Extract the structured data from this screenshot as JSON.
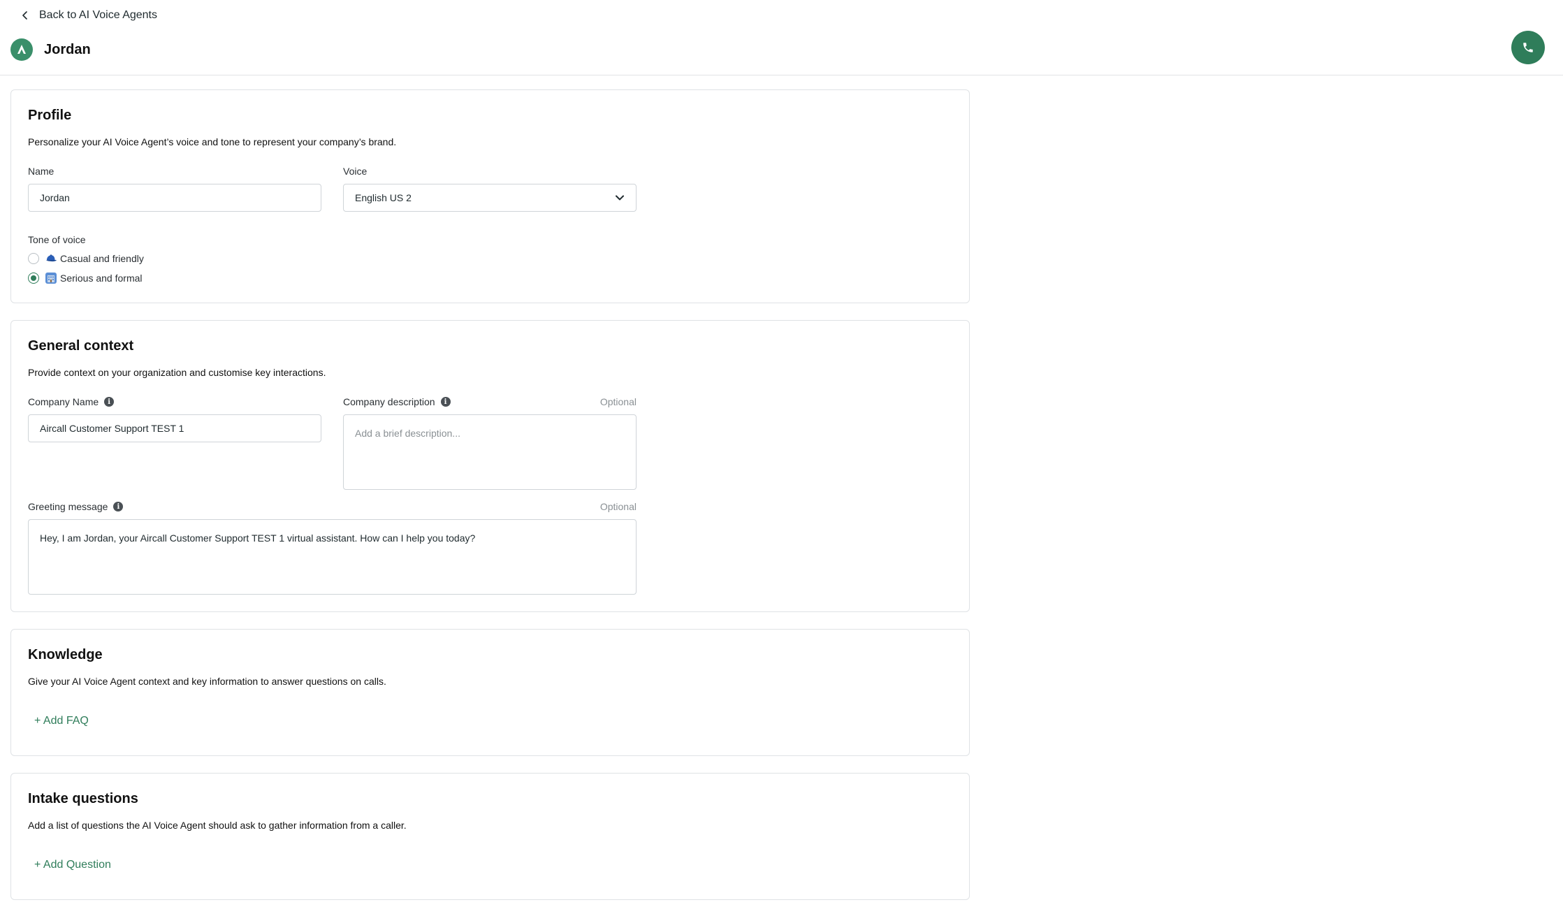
{
  "header": {
    "back_label": "Back to AI Voice Agents",
    "agent_name": "Jordan"
  },
  "profile": {
    "title": "Profile",
    "description": "Personalize your AI Voice Agent’s voice and tone to represent your company’s brand.",
    "name_label": "Name",
    "name_value": "Jordan",
    "voice_label": "Voice",
    "voice_value": "English US 2",
    "tone_label": "Tone of voice",
    "tone_options": [
      {
        "label": "Casual and friendly",
        "selected": false,
        "icon": "cap-emoji-icon"
      },
      {
        "label": "Serious and formal",
        "selected": true,
        "icon": "office-emoji-icon"
      }
    ]
  },
  "general_context": {
    "title": "General context",
    "description": "Provide context on your organization and customise key interactions.",
    "company_name_label": "Company Name",
    "company_name_value": "Aircall Customer Support TEST 1",
    "company_description_label": "Company description",
    "company_description_optional": "Optional",
    "company_description_placeholder": "Add a brief description...",
    "greeting_label": "Greeting message",
    "greeting_optional": "Optional",
    "greeting_value": "Hey, I am Jordan, your Aircall Customer Support TEST 1 virtual assistant. How can I help you today?"
  },
  "knowledge": {
    "title": "Knowledge",
    "description": "Give your AI Voice Agent context and key information to answer questions on calls.",
    "add_label": "+ Add FAQ"
  },
  "intake": {
    "title": "Intake questions",
    "description": "Add a list of questions the AI Voice Agent should ask to gather information from a caller.",
    "add_label": "+ Add Question"
  },
  "colors": {
    "accent": "#2f7d5a",
    "avatar": "#3a8f6a",
    "border": "#dfe2e5"
  }
}
